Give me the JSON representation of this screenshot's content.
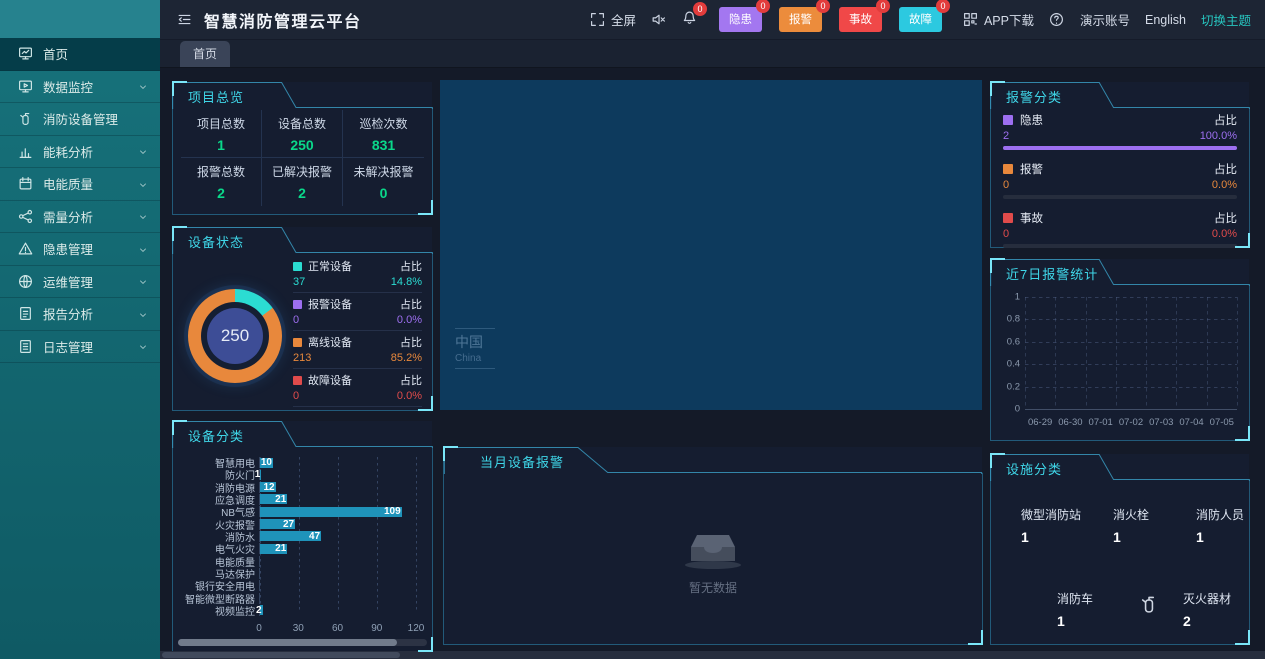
{
  "app": {
    "title": "智慧消防管理云平台"
  },
  "header": {
    "fullscreen": "全屏",
    "bell_badge": "0",
    "chips": [
      {
        "label": "隐患",
        "count": "0",
        "color": "#a377f0"
      },
      {
        "label": "报警",
        "count": "0",
        "color": "#ec8c3c"
      },
      {
        "label": "事故",
        "count": "0",
        "color": "#f04848"
      },
      {
        "label": "故障",
        "count": "0",
        "color": "#2cc9e0"
      }
    ],
    "app_download": "APP下载",
    "account": "演示账号",
    "language": "English",
    "theme_switch": "切换主题"
  },
  "tabs": [
    {
      "label": "首页",
      "active": true
    }
  ],
  "sidebar": {
    "items": [
      {
        "label": "首页",
        "icon": "dashboard",
        "active": true,
        "chevron": false
      },
      {
        "label": "数据监控",
        "icon": "data-monitor",
        "active": false,
        "chevron": true
      },
      {
        "label": "消防设备管理",
        "icon": "fire-extinguisher",
        "active": false,
        "chevron": false
      },
      {
        "label": "能耗分析",
        "icon": "energy-chart",
        "active": false,
        "chevron": true
      },
      {
        "label": "电能质量",
        "icon": "power-quality",
        "active": false,
        "chevron": true
      },
      {
        "label": "需量分析",
        "icon": "demand-share",
        "active": false,
        "chevron": true
      },
      {
        "label": "隐患管理",
        "icon": "hazard-warning",
        "active": false,
        "chevron": true
      },
      {
        "label": "运维管理",
        "icon": "ops-globe",
        "active": false,
        "chevron": true
      },
      {
        "label": "报告分析",
        "icon": "report",
        "active": false,
        "chevron": true
      },
      {
        "label": "日志管理",
        "icon": "log",
        "active": false,
        "chevron": true
      }
    ]
  },
  "panels": {
    "project_overview": {
      "title": "项目总览",
      "value_color": "#0ad88a",
      "stats": [
        {
          "label": "项目总数",
          "value": "1"
        },
        {
          "label": "设备总数",
          "value": "250"
        },
        {
          "label": "巡检次数",
          "value": "831"
        },
        {
          "label": "报警总数",
          "value": "2"
        },
        {
          "label": "已解决报警",
          "value": "2"
        },
        {
          "label": "未解决报警",
          "value": "0"
        }
      ]
    },
    "device_status": {
      "title": "设备状态"
    },
    "device_category": {
      "title": "设备分类"
    },
    "map": {
      "country": "中国",
      "country_en": "China"
    },
    "month_alarm": {
      "title": "当月设备报警",
      "empty_text": "暂无数据"
    },
    "alarm_category": {
      "title": "报警分类"
    },
    "alarm_week": {
      "title": "近7日报警统计"
    },
    "facility": {
      "title": "设施分类",
      "items": [
        {
          "label": "微型消防站",
          "value": "1"
        },
        {
          "label": "消火栓",
          "value": "1"
        },
        {
          "label": "消防人员",
          "value": "1"
        },
        {
          "label": "消防车",
          "value": "1"
        },
        {
          "label": "灭火器材",
          "value": "2",
          "icon": "fire-extinguisher"
        }
      ]
    }
  },
  "chart_data": [
    {
      "id": "device_status",
      "type": "pie",
      "title": "设备状态",
      "center_total": "250",
      "ratio_label": "占比",
      "legend_position": "right",
      "series": [
        {
          "name": "正常设备",
          "value": 37,
          "percent": 14.8,
          "percent_label": "14.8%",
          "color": "#2bdcd2"
        },
        {
          "name": "报警设备",
          "value": 0,
          "percent": 0.0,
          "percent_label": "0.0%",
          "color": "#9d6ff0"
        },
        {
          "name": "离线设备",
          "value": 213,
          "percent": 85.2,
          "percent_label": "85.2%",
          "color": "#e8883c"
        },
        {
          "name": "故障设备",
          "value": 0,
          "percent": 0.0,
          "percent_label": "0.0%",
          "color": "#e04b4b"
        }
      ]
    },
    {
      "id": "device_category",
      "type": "bar",
      "title": "设备分类",
      "orientation": "horizontal",
      "categories": [
        "智慧用电",
        "防火门",
        "消防电源",
        "应急调度",
        "NB气感",
        "火灾报警",
        "消防水",
        "电气火灾",
        "电能质量",
        "马达保护",
        "银行安全用电",
        "智能微型断路器",
        "视频监控"
      ],
      "values": [
        10,
        1,
        12,
        21,
        109,
        27,
        47,
        21,
        0,
        0,
        0,
        0,
        2
      ],
      "xlim": [
        0,
        120
      ],
      "xticks": [
        0,
        30,
        60,
        90,
        120
      ],
      "bar_color": "#1f93ba",
      "grid": "dashed"
    },
    {
      "id": "alarm_category",
      "type": "bar",
      "title": "报警分类",
      "ratio_label": "占比",
      "series": [
        {
          "name": "隐患",
          "value": 2,
          "percent": 100.0,
          "percent_label": "100.0%",
          "color": "#9d6ff0"
        },
        {
          "name": "报警",
          "value": 0,
          "percent": 0.0,
          "percent_label": "0.0%",
          "color": "#e8883c"
        },
        {
          "name": "事故",
          "value": 0,
          "percent": 0.0,
          "percent_label": "0.0%",
          "color": "#e04b4b"
        }
      ]
    },
    {
      "id": "alarm_week",
      "type": "line",
      "title": "近7日报警统计",
      "x": [
        "06-29",
        "06-30",
        "07-01",
        "07-02",
        "07-03",
        "07-04",
        "07-05"
      ],
      "series": [],
      "ylim": [
        0,
        1
      ],
      "yticks": [
        0,
        0.2,
        0.4,
        0.6,
        0.8,
        1
      ],
      "grid": "dashed"
    }
  ]
}
